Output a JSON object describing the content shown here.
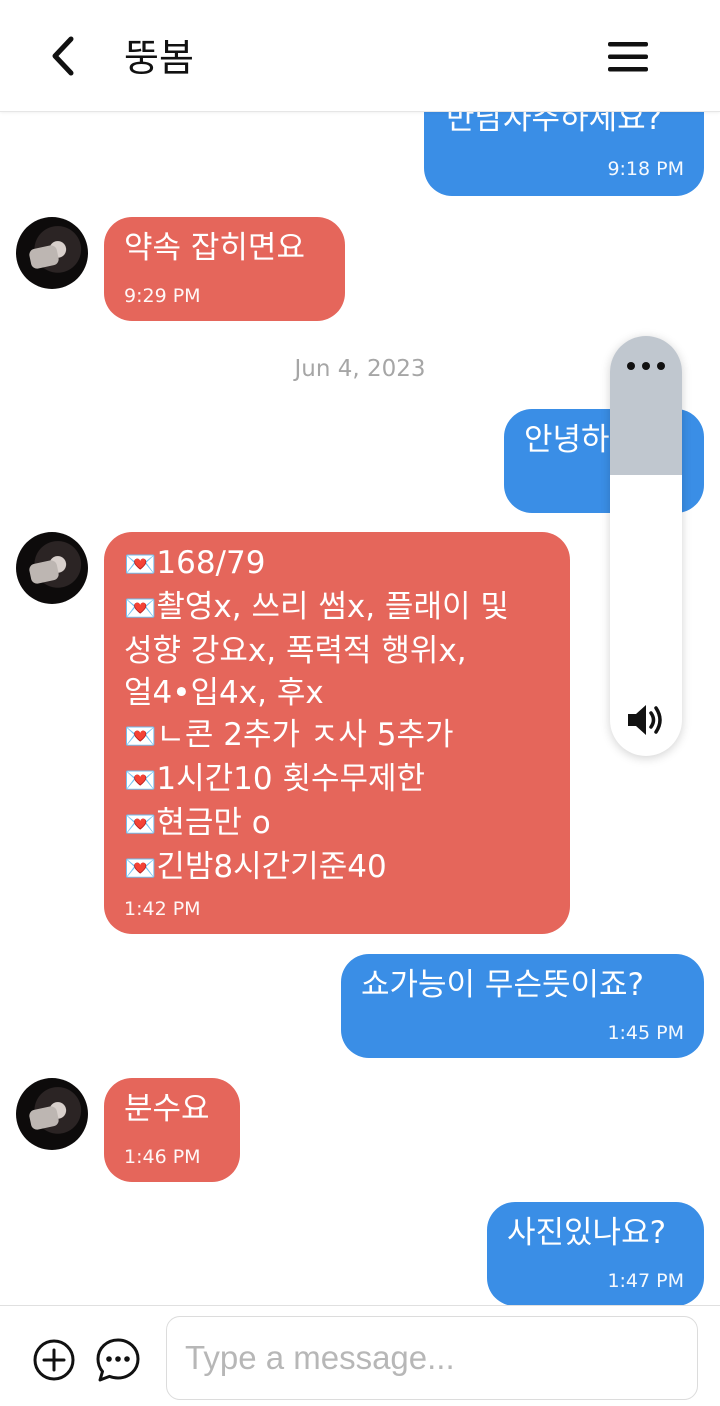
{
  "header": {
    "title": "뚱봄"
  },
  "date_separator": "Jun 4, 2023",
  "messages": [
    {
      "dir": "out",
      "text": "만남자주하세요?",
      "time": "9:18 PM"
    },
    {
      "dir": "in",
      "text": "약속 잡히면요",
      "time": "9:29 PM"
    },
    {
      "dir": "out",
      "text": "안녕하세요",
      "time": ""
    },
    {
      "dir": "in",
      "lines": [
        "168/79",
        "촬영x, 쓰리 썸x, 플래이 및",
        "성향 강요x,  폭력적 행위x,",
        "얼4•입4x, 후x",
        "ㄴ콘 2추가 ㅈ사 5추가",
        "1시간10 횟수무제한",
        "현금만 o",
        "긴밤8시간기준40"
      ],
      "time": "1:42 PM"
    },
    {
      "dir": "out",
      "text": "쇼가능이  무슨뜻이죠?",
      "time": "1:45 PM"
    },
    {
      "dir": "in",
      "text": "분수요",
      "time": "1:46 PM"
    },
    {
      "dir": "out",
      "text": "사진있나요?",
      "time": "1:47 PM"
    }
  ],
  "volume": {
    "level": 0.33
  },
  "composer": {
    "placeholder": "Type a message..."
  },
  "colors": {
    "incoming": "#e5665b",
    "outgoing": "#3a8ee6"
  },
  "icons": {
    "back": "chevron-left-icon",
    "menu": "hamburger-menu-icon",
    "add": "plus-circle-icon",
    "emoji": "chat-bubble-icon",
    "volume": "speaker-icon",
    "more": "more-dots-icon",
    "heart": "love-letter-icon"
  }
}
